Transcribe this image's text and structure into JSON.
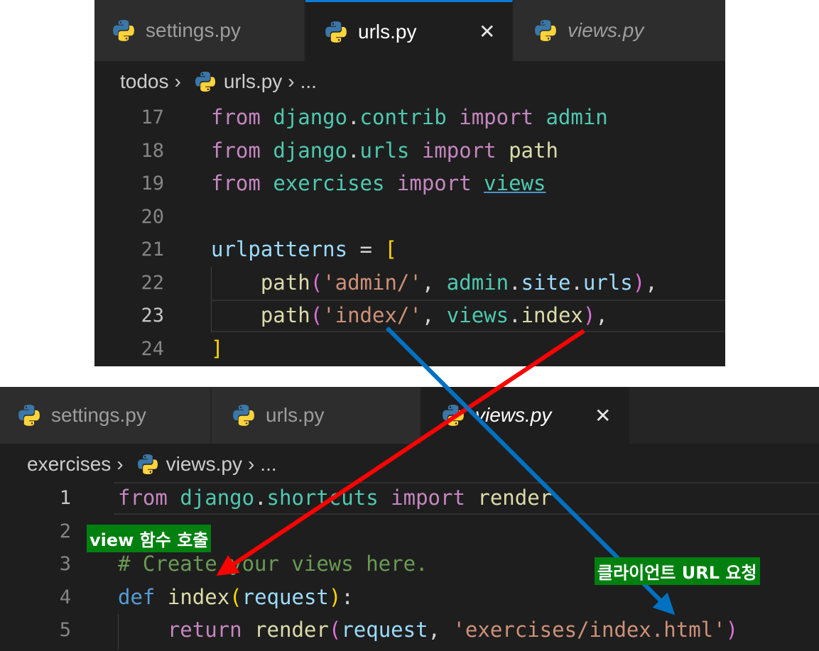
{
  "top_editor": {
    "tabs": [
      {
        "label": "settings.py",
        "active": false,
        "italic": false
      },
      {
        "label": "urls.py",
        "active": true,
        "italic": false,
        "close": "✕"
      },
      {
        "label": "views.py",
        "active": false,
        "italic": true
      }
    ],
    "breadcrumb": {
      "folder": "todos",
      "file": "urls.py",
      "ellipsis": "..."
    },
    "line_numbers": [
      "17",
      "18",
      "19",
      "20",
      "21",
      "22",
      "23",
      "24"
    ],
    "current_line": "23"
  },
  "bottom_editor": {
    "tabs": [
      {
        "label": "settings.py",
        "active": false,
        "italic": false
      },
      {
        "label": "urls.py",
        "active": false,
        "italic": false
      },
      {
        "label": "views.py",
        "active": true,
        "italic": true,
        "close": "✕"
      }
    ],
    "breadcrumb": {
      "folder": "exercises",
      "file": "views.py",
      "ellipsis": "..."
    },
    "line_numbers": [
      "1",
      "2",
      "3",
      "4",
      "5"
    ],
    "current_line": "1"
  },
  "annotations": {
    "view_call": "view 함수 호출",
    "client_request": "클라이언트 URL 요청"
  },
  "arrow_colors": {
    "view_call": "#ff0000",
    "client_request": "#0070c0"
  },
  "icon_names": [
    "python-file-icon",
    "close-icon"
  ]
}
